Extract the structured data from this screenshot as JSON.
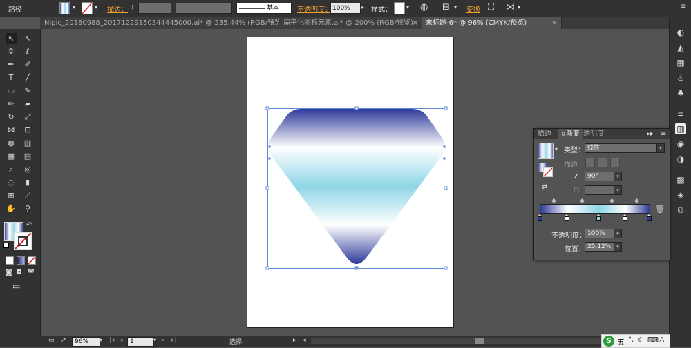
{
  "control_bar": {
    "object_type": "路径",
    "stroke_label": "描边：",
    "brush_style": "基本",
    "opacity_label": "不透明度：",
    "opacity_value": "100%",
    "style_label": "样式：",
    "transform_label": "变换",
    "colors": {
      "accent_link": "#f0a030"
    }
  },
  "tabs": [
    {
      "label": "Nipic_20180988_20171229150344445000.ai* @ 235.44% (RGB/预览)",
      "close": "×"
    },
    {
      "label": "扁平化图标元素.ai* @ 200% (RGB/预览)",
      "close": "×"
    },
    {
      "label": "未标题-6* @ 96% (CMYK/预览)",
      "close": "×"
    }
  ],
  "tools": [
    {
      "name": "selection-tool-icon",
      "glyph": "↖"
    },
    {
      "name": "direct-selection-tool-icon",
      "glyph": "↖"
    },
    {
      "name": "magic-wand-tool-icon",
      "glyph": "✲"
    },
    {
      "name": "lasso-tool-icon",
      "glyph": "ℓ"
    },
    {
      "name": "pen-tool-icon",
      "glyph": "✒"
    },
    {
      "name": "curvature-tool-icon",
      "glyph": "✐"
    },
    {
      "name": "type-tool-icon",
      "glyph": "T"
    },
    {
      "name": "line-segment-tool-icon",
      "glyph": "╱"
    },
    {
      "name": "rectangle-tool-icon",
      "glyph": "▭"
    },
    {
      "name": "paintbrush-tool-icon",
      "glyph": "✎"
    },
    {
      "name": "pencil-tool-icon",
      "glyph": "✏"
    },
    {
      "name": "eraser-tool-icon",
      "glyph": "▰"
    },
    {
      "name": "rotate-tool-icon",
      "glyph": "↻"
    },
    {
      "name": "scale-tool-icon",
      "glyph": "⤢"
    },
    {
      "name": "width-tool-icon",
      "glyph": "⋈"
    },
    {
      "name": "free-transform-tool-icon",
      "glyph": "⊡"
    },
    {
      "name": "shape-builder-tool-icon",
      "glyph": "◍"
    },
    {
      "name": "graph-tool-icon",
      "glyph": "▥"
    },
    {
      "name": "mesh-tool-icon",
      "glyph": "▦"
    },
    {
      "name": "gradient-tool-icon",
      "glyph": "▤"
    },
    {
      "name": "eyedropper-tool-icon",
      "glyph": "⌕"
    },
    {
      "name": "blend-tool-icon",
      "glyph": "◎"
    },
    {
      "name": "symbol-sprayer-tool-icon",
      "glyph": "◌"
    },
    {
      "name": "column-graph-tool-icon",
      "glyph": "▮"
    },
    {
      "name": "artboard-tool-icon",
      "glyph": "⊞"
    },
    {
      "name": "slice-tool-icon",
      "glyph": "⟋"
    },
    {
      "name": "hand-tool-icon",
      "glyph": "✋"
    },
    {
      "name": "zoom-tool-icon",
      "glyph": "⚲"
    }
  ],
  "dock_icons": [
    {
      "name": "color-panel-icon",
      "glyph": "◐"
    },
    {
      "name": "color-guide-icon",
      "glyph": "◭"
    },
    {
      "name": "swatches-icon",
      "glyph": "▦"
    },
    {
      "name": "brushes-icon",
      "glyph": "♨"
    },
    {
      "name": "symbols-icon",
      "glyph": "♣"
    },
    {
      "name": "stroke-panel-icon",
      "glyph": "≡"
    },
    {
      "name": "gradient-panel-icon",
      "glyph": "▥"
    },
    {
      "name": "transparency-icon",
      "glyph": "◉"
    },
    {
      "name": "appearance-icon",
      "glyph": "◑"
    },
    {
      "name": "graphic-styles-icon",
      "glyph": "▩"
    },
    {
      "name": "layers-icon",
      "glyph": "◈"
    },
    {
      "name": "artboards-icon",
      "glyph": "⧉"
    }
  ],
  "gradient_panel": {
    "tabs": [
      "描边",
      "渐变",
      "透明度"
    ],
    "type_label": "类型：",
    "type_value": "线性",
    "stroke_label": "描边",
    "angle_value": "90°",
    "opacity_label": "不透明度：",
    "opacity_value": "100%",
    "location_label": "位置：",
    "location_value": "25.12%",
    "stops": [
      {
        "location": 0,
        "color": "#2e3a9a"
      },
      {
        "location": 0.25,
        "color": "#ffffff"
      },
      {
        "location": 0.54,
        "color": "#8fd6e6"
      },
      {
        "location": 0.78,
        "color": "#ffffff"
      },
      {
        "location": 1,
        "color": "#2e3a9a"
      }
    ],
    "midpoints": [
      0.13,
      0.39,
      0.66,
      0.89
    ]
  },
  "status_bar": {
    "zoom": "96%",
    "page": "1",
    "tool_name": "选择"
  },
  "ime": {
    "labels": [
      "五",
      "⌨"
    ]
  }
}
